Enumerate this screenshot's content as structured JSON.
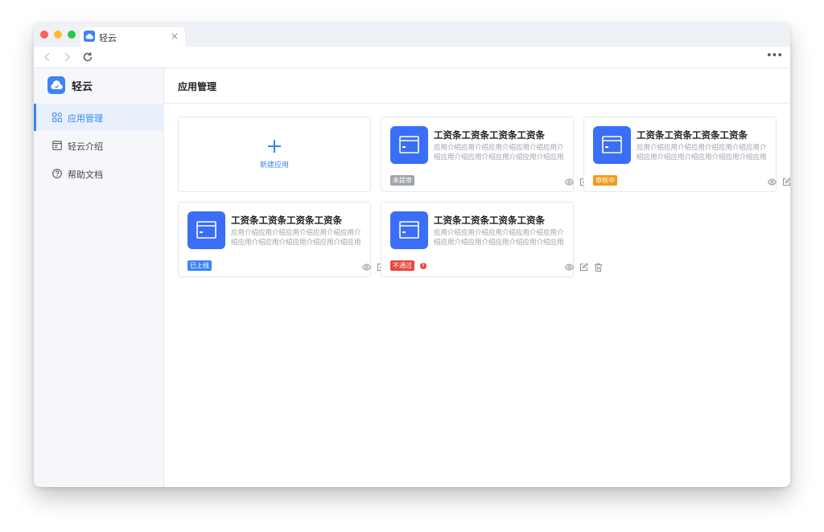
{
  "browser": {
    "tab_title": "轻云",
    "tab_close": "×",
    "more": "•••"
  },
  "sidebar": {
    "brand": "轻云",
    "items": [
      {
        "label": "应用管理",
        "icon": "grid-icon",
        "active": true
      },
      {
        "label": "轻云介绍",
        "icon": "document-icon",
        "active": false
      },
      {
        "label": "帮助文档",
        "icon": "question-circle-icon",
        "active": false
      }
    ]
  },
  "header": {
    "title": "应用管理"
  },
  "new_app": {
    "label": "新建应用"
  },
  "apps": [
    {
      "title": "工资条工资条工资条工资条",
      "desc": "应用介绍应用介绍应用介绍应用介绍应用介绍应用介绍应用介绍应用介绍应用介绍应用介绍应...",
      "status": "未提审",
      "status_color": "#a0a4ab"
    },
    {
      "title": "工资条工资条工资条工资条",
      "desc": "应用介绍应用介绍应用介绍应用介绍应用介绍应用介绍应用介绍应用介绍应用介绍应用介绍应...",
      "status": "审核中",
      "status_color": "#f29a1f"
    },
    {
      "title": "工资条工资条工资条工资条",
      "desc": "应用介绍应用介绍应用介绍应用介绍应用介绍应用介绍应用介绍应用介绍应用介绍应用介绍应...",
      "status": "已上线",
      "status_color": "#3a84f6"
    },
    {
      "title": "工资条工资条工资条工资条",
      "desc": "应用介绍应用介绍应用介绍应用介绍应用介绍应用介绍应用介绍应用介绍应用介绍应用介绍应...",
      "status": "不通过",
      "status_color": "#e8473f",
      "warning": "!"
    }
  ],
  "colors": {
    "accent": "#3a84f6",
    "app_icon": "#3b6ef6"
  }
}
